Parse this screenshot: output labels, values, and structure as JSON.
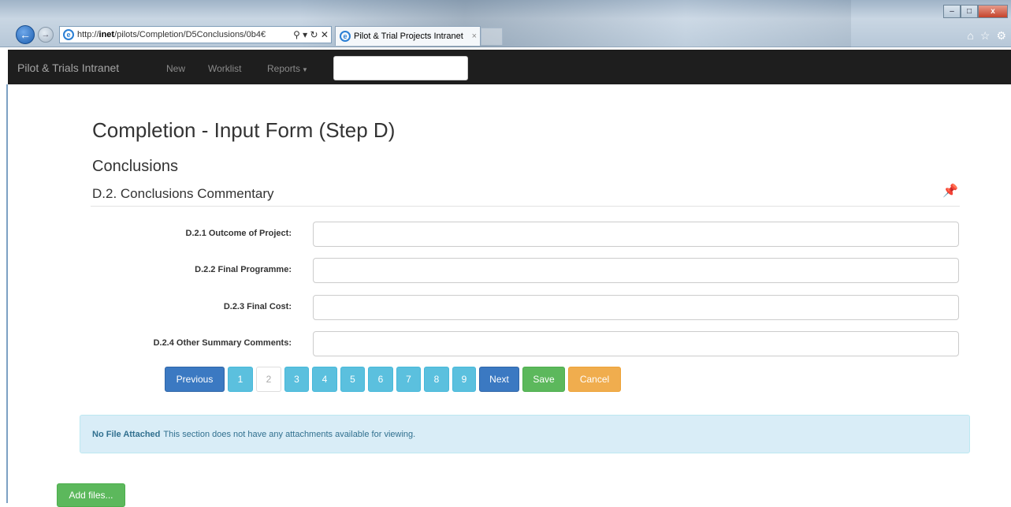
{
  "browser": {
    "url_prefix": "http://",
    "url_host": "inet",
    "url_path": "/pilots/Completion/D5Conclusions/0b4€",
    "search_glyph": "⚲ ▾ ↻ ✕",
    "tab_title": "Pilot & Trial Projects Intranet",
    "tab_close": "×"
  },
  "navbar": {
    "brand": "Pilot & Trials Intranet",
    "new": "New",
    "worklist": "Worklist",
    "reports": "Reports",
    "search_value": ""
  },
  "page": {
    "title": "Completion - Input Form (Step D)",
    "section": "Conclusions",
    "subsection": "D.2. Conclusions Commentary"
  },
  "fields": [
    {
      "label": "D.2.1 Outcome of Project:",
      "value": ""
    },
    {
      "label": "D.2.2 Final Programme:",
      "value": ""
    },
    {
      "label": "D.2.3 Final Cost:",
      "value": ""
    },
    {
      "label": "D.2.4 Other Summary Comments:",
      "value": ""
    }
  ],
  "pager": {
    "previous": "Previous",
    "pages": [
      "1",
      "2",
      "3",
      "4",
      "5",
      "6",
      "7",
      "8",
      "9"
    ],
    "current_page": "2",
    "next": "Next",
    "save": "Save",
    "cancel": "Cancel"
  },
  "alert": {
    "title": "No File Attached",
    "message": "This section does not have any attachments available for viewing."
  },
  "add_files": "Add files...",
  "colors": {
    "primary": "#3b79c2",
    "info": "#5bc0de",
    "success": "#5cb85c",
    "warning": "#f0ad4e",
    "navbar": "#1e1e1e"
  }
}
